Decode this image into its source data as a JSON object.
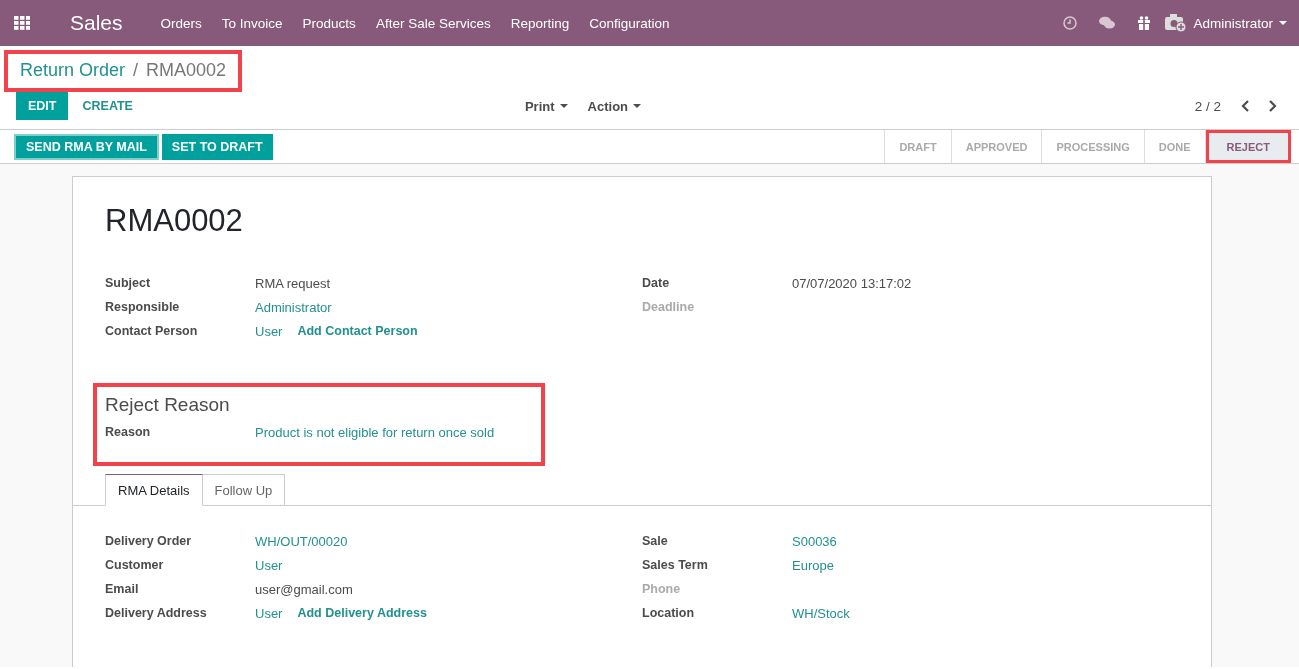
{
  "navbar": {
    "app_name": "Sales",
    "menu": [
      "Orders",
      "To Invoice",
      "Products",
      "After Sale Services",
      "Reporting",
      "Configuration"
    ],
    "user": "Administrator"
  },
  "breadcrumb": {
    "parent": "Return Order",
    "separator": "/",
    "current": "RMA0002",
    "highlighted": true
  },
  "control_buttons": {
    "primary": "EDIT",
    "secondary": "CREATE",
    "dropdowns": [
      "Print",
      "Action"
    ],
    "pager": "2 / 2"
  },
  "header_buttons": [
    "SEND RMA BY MAIL",
    "SET TO DRAFT"
  ],
  "status_stages": [
    {
      "label": "DRAFT",
      "selected": false,
      "highlighted": false
    },
    {
      "label": "APPROVED",
      "selected": false,
      "highlighted": false
    },
    {
      "label": "PROCESSING",
      "selected": false,
      "highlighted": false
    },
    {
      "label": "DONE",
      "selected": false,
      "highlighted": false
    },
    {
      "label": "REJECT",
      "selected": true,
      "highlighted": true
    }
  ],
  "record": {
    "title": "RMA0002",
    "left_fields": [
      {
        "label": "Subject",
        "value": "RMA request",
        "kind": "text",
        "empty": false
      },
      {
        "label": "Responsible",
        "value": "Administrator",
        "kind": "link",
        "empty": false
      },
      {
        "label": "Contact Person",
        "value": "User",
        "kind": "link",
        "empty": false,
        "action": "Add Contact Person"
      }
    ],
    "right_fields": [
      {
        "label": "Date",
        "value": "07/07/2020 13:17:02",
        "kind": "text",
        "empty": false
      },
      {
        "label": "Deadline",
        "empty": true
      }
    ],
    "reject_section": {
      "title": "Reject Reason",
      "highlighted": true,
      "fields": [
        {
          "label": "Reason",
          "value": "Product is not eligible for return once sold",
          "kind": "link",
          "empty": false
        }
      ]
    },
    "tabs": [
      {
        "label": "RMA Details",
        "selected": true
      },
      {
        "label": "Follow Up",
        "selected": false
      }
    ],
    "details_left": [
      {
        "label": "Delivery Order",
        "value": "WH/OUT/00020",
        "kind": "link",
        "empty": false
      },
      {
        "label": "Customer",
        "value": "User",
        "kind": "link",
        "empty": false
      },
      {
        "label": "Email",
        "value": "user@gmail.com",
        "kind": "text",
        "empty": false
      },
      {
        "label": "Delivery Address",
        "value": "User",
        "kind": "link",
        "empty": false,
        "action": "Add Delivery Address"
      }
    ],
    "details_right": [
      {
        "label": "Sale",
        "value": "S00036",
        "kind": "link",
        "empty": false
      },
      {
        "label": "Sales Term",
        "value": "Europe",
        "kind": "link",
        "empty": false
      },
      {
        "label": "Phone",
        "empty": true
      },
      {
        "label": "Location",
        "value": "WH/Stock",
        "kind": "link",
        "empty": false
      }
    ]
  }
}
